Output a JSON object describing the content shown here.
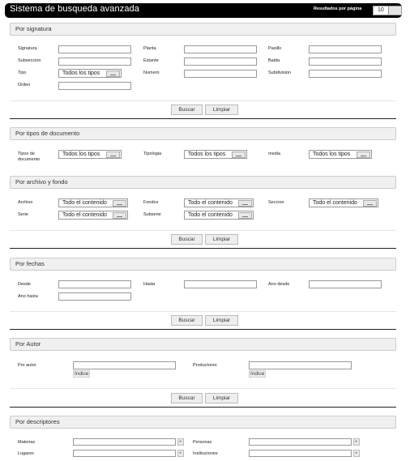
{
  "header": {
    "title": "Sistema de busqueda avanzada",
    "results_per_page_label": "Resultados por página",
    "results_per_page_value": "10"
  },
  "actions": {
    "search_label": "Buscar",
    "clear_label": "Limpiar"
  },
  "signatura": {
    "title": "Por signatura",
    "labels": {
      "signatura": "Signatura",
      "planta": "Planta",
      "pasillo": "Pasillo",
      "subseccion": "Subseccion",
      "estante": "Estante",
      "balda": "Balda",
      "tipo": "Tipo",
      "numero": "Numero",
      "subdivision": "Subdivision",
      "orden": "Orden"
    },
    "tipo_value": "Todos los tipos"
  },
  "tipos": {
    "title": "Por tipos de documento",
    "labels": {
      "tipo_documento": "Tipos de documento",
      "tipologia": "Tipologia",
      "media": "media"
    },
    "values": {
      "tipo_documento": "Todos los tipos",
      "tipologia": "Todos los tipos",
      "media": "Todos los tipos"
    }
  },
  "archivo": {
    "title": "Por archivo y fondo",
    "labels": {
      "archivo": "Archivo",
      "fondos": "Fondos",
      "seccion": "Seccion",
      "serie": "Serie",
      "subserie": "Subserie"
    },
    "values": {
      "archivo": "Todo el contenido",
      "fondos": "Todo el contenido",
      "seccion": "Todo el contenido",
      "serie": "Todo el contenido",
      "subserie": "Todo el contenido"
    }
  },
  "fechas": {
    "title": "Por fechas",
    "labels": {
      "desde": "Desde",
      "hasta": "Hasta",
      "ano_desde": "Ano desde",
      "ano_hasta": "Ano hasta"
    }
  },
  "autor": {
    "title": "Por Autor",
    "labels": {
      "por_autor": "Por autor",
      "productores": "Productores"
    },
    "indice_label": "Indice"
  },
  "descriptores": {
    "title": "Por descriptores",
    "labels": {
      "materias": "Materias",
      "personas": "Personas",
      "lugares": "Lugares",
      "instituciones": "Instituciones"
    }
  }
}
